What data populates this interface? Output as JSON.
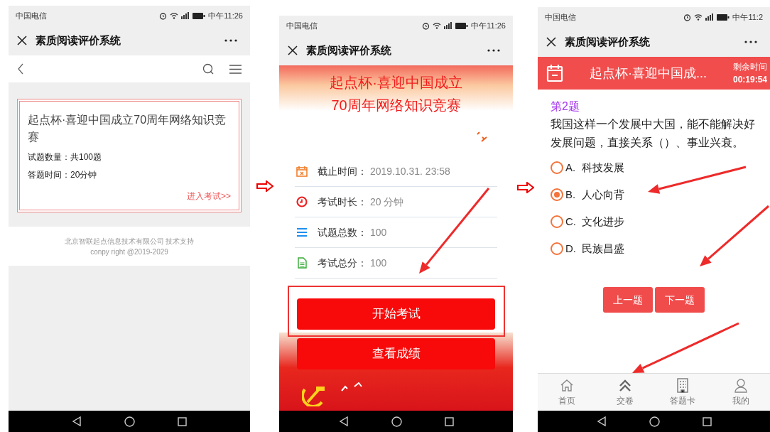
{
  "screens": [
    {
      "kind": "list",
      "status_bar": {
        "carrier": "中国电信",
        "time": "中午11:26"
      },
      "title": "素质阅读评价系统",
      "contest_card": {
        "title": "起点杯·喜迎中国成立70周年网络知识竞赛",
        "lines": [
          "试题数量：共100题",
          "答题时间：20分钟"
        ],
        "link": "进入考试>>"
      },
      "footer": [
        "北京智联起点信息技术有限公司 技术支持",
        "conpy right @2019-2029"
      ]
    },
    {
      "kind": "detail",
      "status_bar": {
        "carrier": "中国电信",
        "time": "中午11:26"
      },
      "title": "素质阅读评价系统",
      "banner_title": "起点杯·喜迎中国成立70周年网络知识竞赛",
      "info": [
        {
          "label": "截止时间：",
          "value": "2019.10.31. 23:58"
        },
        {
          "label": "考试时长：",
          "value": "20 分钟"
        },
        {
          "label": "试题总数：",
          "value": "100"
        },
        {
          "label": "考试总分：",
          "value": "100"
        }
      ],
      "buttons": [
        "开始考试",
        "查看成绩"
      ]
    },
    {
      "kind": "quiz",
      "status_bar": {
        "carrier": "中国电信",
        "time": "中午11:2"
      },
      "title": "素质阅读评价系统",
      "header": {
        "title": "起点杯·喜迎中国成...",
        "timer_label": "剩余时间",
        "timer": "00:19:54"
      },
      "question_number": "第2题",
      "question": "我国这样一个发展中大国，能不能解决好发展问题，直接关系（）、事业兴衰。",
      "options": [
        {
          "letter": "A.",
          "text": "科技发展",
          "selected": false
        },
        {
          "letter": "B.",
          "text": "人心向背",
          "selected": true
        },
        {
          "letter": "C.",
          "text": "文化进步",
          "selected": false
        },
        {
          "letter": "D.",
          "text": "民族昌盛",
          "selected": false
        }
      ],
      "buttons": [
        "上一题",
        "下一题"
      ],
      "tabs": [
        "首页",
        "交卷",
        "答题卡",
        "我的"
      ]
    }
  ]
}
